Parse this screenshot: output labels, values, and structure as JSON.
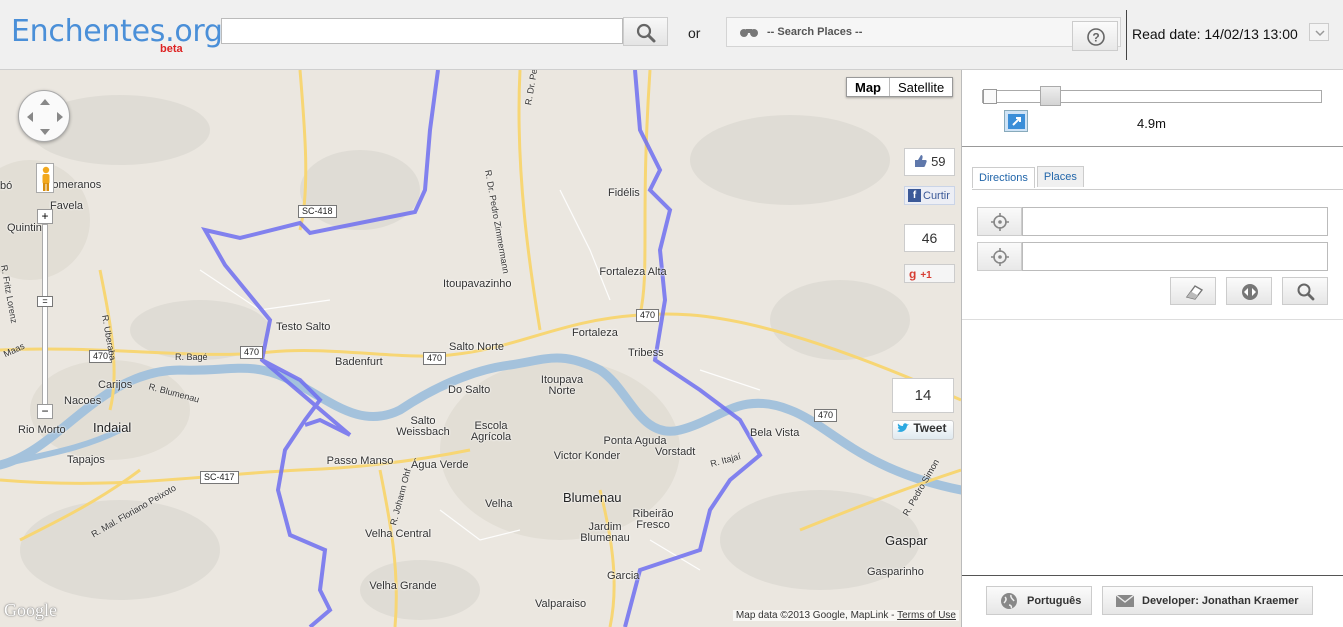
{
  "header": {
    "logo_text": "Enchentes.org",
    "logo_badge": "beta",
    "search_value": "",
    "or_label": "or",
    "places_placeholder": "-- Search Places --",
    "read_date_label": "Read date: 14/02/13 13:00"
  },
  "map": {
    "type_buttons": [
      "Map",
      "Satellite"
    ],
    "places": [
      {
        "name": "Fidélis"
      },
      {
        "name": "Fortaleza Alta"
      },
      {
        "name": "Itoupavazinho"
      },
      {
        "name": "Testo Salto"
      },
      {
        "name": "Fortaleza"
      },
      {
        "name": "Badenfurt"
      },
      {
        "name": "Salto Norte"
      },
      {
        "name": "Tribess"
      },
      {
        "name": "Do Salto"
      },
      {
        "name": "Itoupava Norte"
      },
      {
        "name": "Salto Weissbach"
      },
      {
        "name": "Escola Agrícola"
      },
      {
        "name": "Ponta Aguda"
      },
      {
        "name": "Vorstadt"
      },
      {
        "name": "Bela Vista"
      },
      {
        "name": "Victor Konder"
      },
      {
        "name": "Passo Manso"
      },
      {
        "name": "Água Verde"
      },
      {
        "name": "Blumenau"
      },
      {
        "name": "Velha"
      },
      {
        "name": "Ribeirão Fresco"
      },
      {
        "name": "Jardim Blumenau"
      },
      {
        "name": "Velha Central"
      },
      {
        "name": "Garcia"
      },
      {
        "name": "Velha Grande"
      },
      {
        "name": "Valparaiso"
      },
      {
        "name": "Gaspar"
      },
      {
        "name": "Gasparinho"
      },
      {
        "name": "Indaial"
      },
      {
        "name": "Carijos"
      },
      {
        "name": "Nacoes"
      },
      {
        "name": "Rio Morto"
      },
      {
        "name": "Tapajos"
      },
      {
        "name": "Favela"
      },
      {
        "name": "Quintin"
      },
      {
        "name": "Pomeranos"
      },
      {
        "name": "bó"
      }
    ],
    "roads": [
      "SC-418",
      "470",
      "470",
      "470",
      "470",
      "470",
      "SC-417"
    ],
    "streets": [
      "R. Dr. Pedro Zimmermann",
      "R. Bagé",
      "R. Blumenau",
      "R. Itajaí",
      "R. Pedro Simon",
      "R. Uberaba",
      "R. Fritz Lorenz",
      "R. Johann Ohf",
      "R. Mal. Floriano Peixoto",
      "R. Dr. Pedro",
      "Maas"
    ],
    "google_logo": "Google",
    "attribution_prefix": "Map data ©2013 Google, MapLink - ",
    "attribution_terms": "Terms of Use"
  },
  "social": {
    "facebook_count": "59",
    "facebook_label": "Curtir",
    "gplus_count": "46",
    "gplus_label": "+1",
    "twitter_count": "14",
    "twitter_label": "Tweet"
  },
  "panel": {
    "depth_value": "4.9m",
    "tabs": [
      "Directions",
      "Places"
    ],
    "from_value": "",
    "to_value": "",
    "footer_language": "Português",
    "footer_developer": "Developer: Jonathan Kraemer"
  },
  "colors": {
    "logo": "#4a8fd8",
    "boundary": "#6f6ff0",
    "river": "#a4c2dc",
    "road": "#f7d674"
  }
}
